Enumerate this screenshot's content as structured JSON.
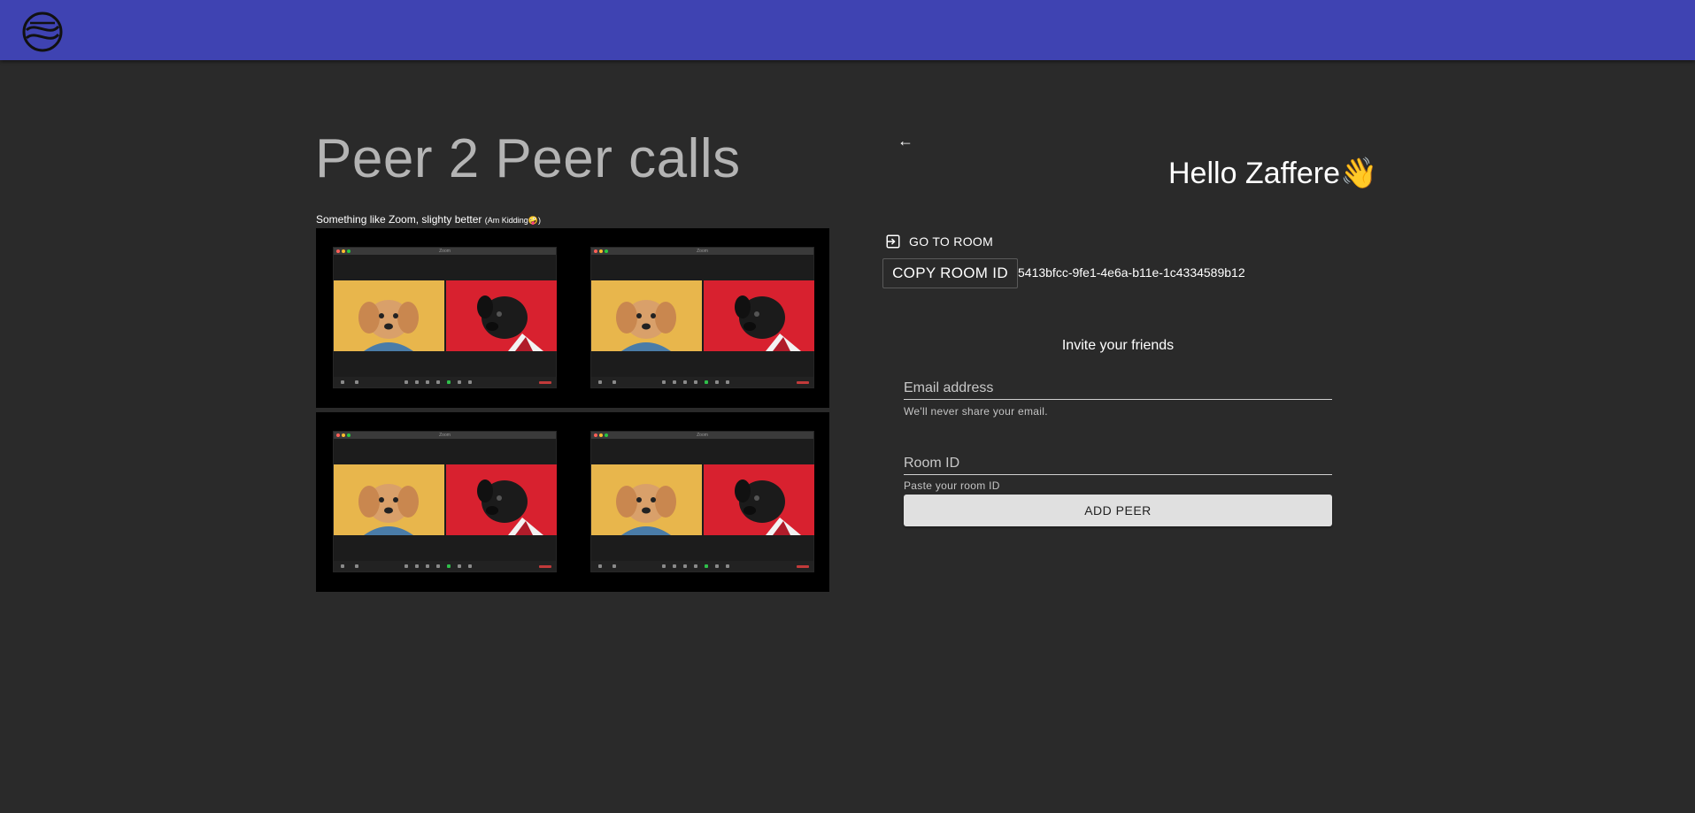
{
  "header": {
    "logo_icon": "app-logo-icon",
    "background": "#3f43b2"
  },
  "left": {
    "title": "Peer 2 Peer calls",
    "tagline": "Something like Zoom, slighty better",
    "tagline_note": "(Am Kidding",
    "tagline_emoji": "🤪",
    "tagline_close": ")",
    "preview_window_title": "Zoom"
  },
  "right": {
    "back_icon": "arrow-left-icon",
    "back_glyph": "←",
    "greeting": "Hello Zaffere👋",
    "go_to_room_label": "GO TO ROOM",
    "go_to_room_icon": "enter-room-icon",
    "copy_room_id_label": "COPY ROOM ID",
    "room_id": "5413bfcc-9fe1-4e6a-b11e-1c4334589b12",
    "invite_title": "Invite your friends",
    "email": {
      "placeholder": "Email address",
      "value": "",
      "helper": "We'll never share your email."
    },
    "room_field": {
      "placeholder": "Room ID",
      "value": "",
      "helper": "Paste your room ID"
    },
    "add_peer_label": "ADD PEER"
  },
  "colors": {
    "page_bg": "#2a2a2a",
    "accent": "#3f43b2",
    "button_bg": "#e0e0e0"
  }
}
